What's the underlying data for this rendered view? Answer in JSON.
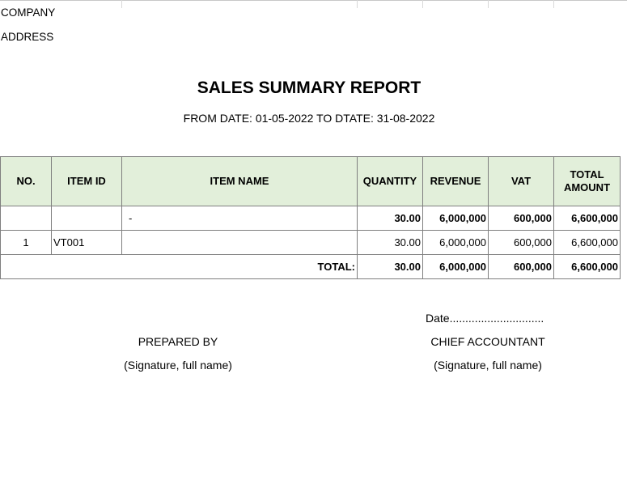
{
  "header": {
    "company_label": "COMPANY",
    "address_label": "ADDRESS"
  },
  "report": {
    "title": "SALES SUMMARY REPORT",
    "date_range": "FROM DATE: 01-05-2022 TO DTATE: 31-08-2022"
  },
  "table": {
    "columns": [
      "NO.",
      "ITEM ID",
      "ITEM NAME",
      "QUANTITY",
      "REVENUE",
      "VAT",
      "TOTAL AMOUNT"
    ],
    "group_row": {
      "no": "",
      "item_id": "",
      "item_name": "-",
      "quantity": "30.00",
      "revenue": "6,000,000",
      "vat": "600,000",
      "total_amount": "6,600,000"
    },
    "rows": [
      {
        "no": "1",
        "item_id": "VT001",
        "item_name": "",
        "quantity": "30.00",
        "revenue": "6,000,000",
        "vat": "600,000",
        "total_amount": "6,600,000"
      }
    ],
    "total_row": {
      "label": "TOTAL:",
      "quantity": "30.00",
      "revenue": "6,000,000",
      "vat": "600,000",
      "total_amount": "6,600,000"
    }
  },
  "signatures": {
    "date_line": "Date..............................",
    "prepared_by": "PREPARED BY",
    "prepared_by_hint": "(Signature, full name)",
    "chief_accountant": "CHIEF ACCOUNTANT",
    "chief_accountant_hint": "(Signature, full name)"
  }
}
